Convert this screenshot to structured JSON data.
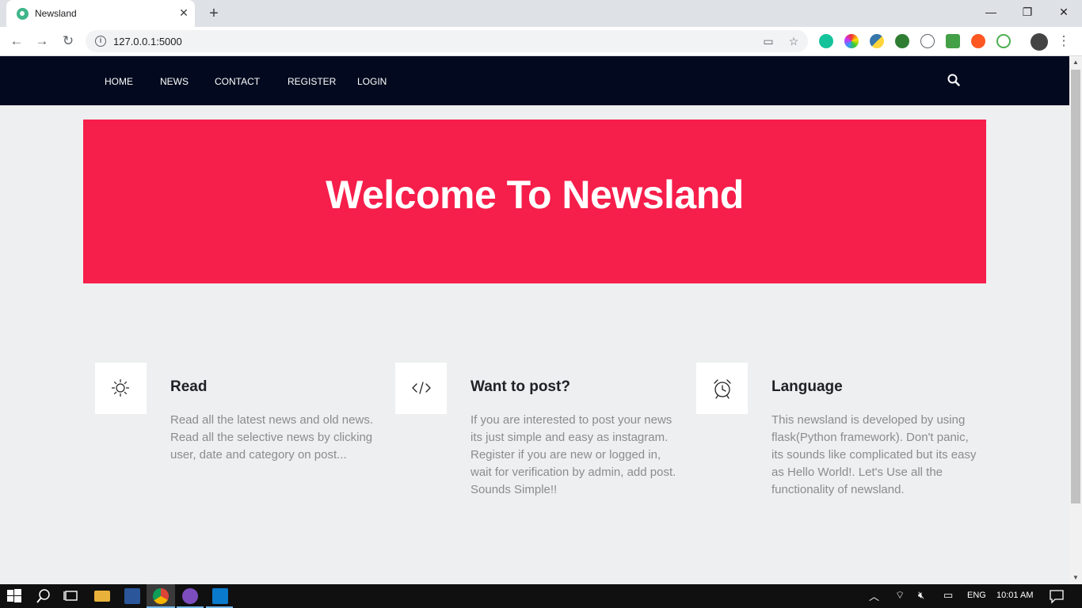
{
  "browser": {
    "tab_title": "Newsland",
    "tab_close": "✕",
    "new_tab": "+",
    "url": "127.0.0.1:5000",
    "window_minimize": "—",
    "window_restore": "❐",
    "window_close": "✕"
  },
  "nav": {
    "links": [
      "HOME",
      "NEWS",
      "CONTACT",
      "REGISTER",
      "LOGIN"
    ]
  },
  "hero": {
    "title": "Welcome To Newsland"
  },
  "features": [
    {
      "icon": "sun-icon",
      "title": "Read",
      "text": "Read all the latest news and old news. Read all the selective news by clicking user, date and category on post..."
    },
    {
      "icon": "code-icon",
      "title": "Want to post?",
      "text": "If you are interested to post your news its just simple and easy as instagram. Register if you are new or logged in, wait for verification by admin, add post. Sounds Simple!!"
    },
    {
      "icon": "alarm-clock-icon",
      "title": "Language",
      "text": "This newsland is developed by using flask(Python framework). Don't panic, its sounds like complicated but its easy as Hello World!. Let's Use all the functionality of newsland."
    }
  ],
  "taskbar": {
    "language": "ENG",
    "time": "10:01 AM"
  },
  "colors": {
    "hero_bg": "#f61e4b",
    "nav_bg": "#030a1f",
    "page_bg": "#edeff0"
  }
}
